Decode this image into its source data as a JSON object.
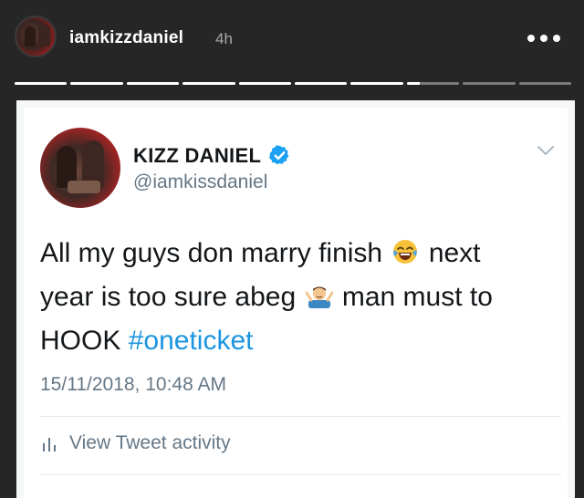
{
  "story": {
    "username": "iamkizzdaniel",
    "time": "4h",
    "progress_segments": [
      1,
      1,
      1,
      1,
      1,
      1,
      1,
      0.25,
      0,
      0
    ]
  },
  "tweet": {
    "display_name": "KIZZ DANIEL",
    "handle": "@iamkissdaniel",
    "text_line1": "All my guys don marry finish",
    "text_line1_end": "next",
    "text_line2": "year is too sure abeg",
    "text_line2_end": "man must to",
    "text_line3": "HOOK",
    "hashtag": "#oneticket",
    "timestamp": "15/11/2018, 10:48 AM",
    "activity_label": "View Tweet activity"
  },
  "colors": {
    "link": "#1b95e0",
    "secondary_text": "#657786",
    "verified": "#1da1f2",
    "story_background": "#262626"
  },
  "icons": {
    "more": "more-horizontal-icon",
    "verified": "verified-badge-icon",
    "chevron": "chevron-down-icon",
    "activity": "bar-chart-icon",
    "emoji1": "face-with-tears-of-joy-emoji",
    "emoji2": "man-shrugging-emoji"
  }
}
